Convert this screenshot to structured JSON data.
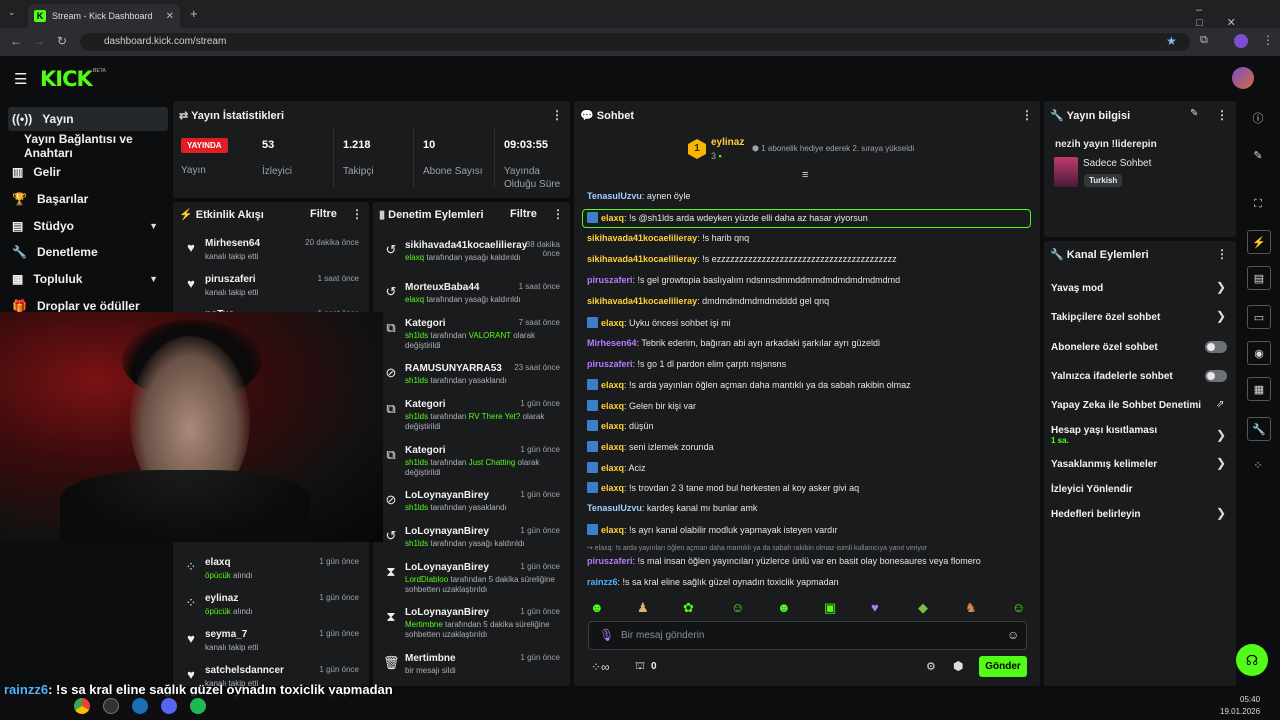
{
  "browser": {
    "tab_title": "Stream - Kick Dashboard",
    "url": "dashboard.kick.com/stream"
  },
  "header": {
    "logo": "KICK",
    "beta": "BETA"
  },
  "sidebar": {
    "items": [
      {
        "label": "Yayın",
        "icon": "broadcast-icon"
      },
      {
        "label": "Yayın Bağlantısı ve Anahtarı",
        "icon": ""
      },
      {
        "label": "Gelir",
        "icon": "chart-icon"
      },
      {
        "label": "Başarılar",
        "icon": "trophy-icon"
      },
      {
        "label": "Stüdyo",
        "icon": "studio-icon"
      },
      {
        "label": "Denetleme",
        "icon": "wrench-icon"
      },
      {
        "label": "Topluluk",
        "icon": "community-icon"
      },
      {
        "label": "Droplar ve ödüller",
        "icon": "gift-icon"
      }
    ]
  },
  "stats": {
    "title": "Yayın İstatistikleri",
    "live": "YAYINDA",
    "live_label": "Yayın",
    "items": [
      {
        "value": "53",
        "label": "İzleyici"
      },
      {
        "value": "1.218",
        "label": "Takipçi"
      },
      {
        "value": "10",
        "label": "Abone Sayısı"
      },
      {
        "value": "09:03:55",
        "label": "Yayında Olduğu Süre"
      }
    ]
  },
  "activity": {
    "title": "Etkinlik Akışı",
    "filter": "Filtre",
    "items": [
      {
        "name": "Mirhesen64",
        "sub": "kanalı takip etti",
        "time": "20 dakika önce",
        "icon": "heart-icon"
      },
      {
        "name": "piruszaferi",
        "sub": "kanalı takip etti",
        "time": "1 saat önce",
        "icon": "heart-icon"
      },
      {
        "name": "noTua",
        "sub": "",
        "time": "1 saat önce",
        "icon": "heart-icon"
      },
      {
        "name": "",
        "sub": "kanalı takip etti",
        "time": "",
        "icon": ""
      },
      {
        "name": "elaxq",
        "sub": "öpücük",
        "sub2": " alındı",
        "time": "1 gün önce",
        "icon": "dots-icon"
      },
      {
        "name": "eylinaz",
        "sub": "öpücük",
        "sub2": " alındı",
        "time": "1 gün önce",
        "icon": "dots-icon"
      },
      {
        "name": "seyma_7",
        "sub": "kanalı takip etti",
        "time": "1 gün önce",
        "icon": "heart-icon"
      },
      {
        "name": "satchelsdanncer",
        "sub": "kanalı takip etti",
        "time": "1 gün önce",
        "icon": "heart-icon"
      }
    ]
  },
  "moderation": {
    "title": "Denetim Eylemleri",
    "filter": "Filtre",
    "items": [
      {
        "name": "sikihavada41kocaelilieray",
        "a": "elaxq",
        "t": " tarafından yasağı kaldırıldı",
        "time": "38 dakika önce",
        "icon": "undo-icon"
      },
      {
        "name": "MorteuxBaba44",
        "a": "elaxq",
        "t": " tarafından yasağı kaldırıldı",
        "time": "1 saat önce",
        "icon": "undo-icon"
      },
      {
        "name": "Kategori",
        "a": "sh1lds",
        "t": " tarafından ",
        "b": "VALORANT",
        "c": " olarak değiştirildi",
        "time": "7 saat önce",
        "icon": "category-icon"
      },
      {
        "name": "RAMUSUNYARRA53",
        "a": "sh1lds",
        "t": " tarafından yasaklandı",
        "time": "23 saat önce",
        "icon": "ban-icon"
      },
      {
        "name": "Kategori",
        "a": "sh1lds",
        "t": " tarafından ",
        "b": "RV There Yet?",
        "c": " olarak değiştirildi",
        "time": "1 gün önce",
        "icon": "category-icon"
      },
      {
        "name": "Kategori",
        "a": "sh1lds",
        "t": " tarafından ",
        "b": "Just Chatting",
        "c": " olarak değiştirildi",
        "time": "1 gün önce",
        "icon": "category-icon"
      },
      {
        "name": "LoLoynayanBirey",
        "a": "sh1lds",
        "t": " tarafından yasaklandı",
        "time": "1 gün önce",
        "icon": "ban-icon"
      },
      {
        "name": "LoLoynayanBirey",
        "a": "sh1lds",
        "t": " tarafından yasağı kaldırıldı",
        "time": "1 gün önce",
        "icon": "undo-icon"
      },
      {
        "name": "LoLoynayanBirey",
        "a": "LordDiabloo",
        "t": " tarafından 5 dakika süreliğine sohbetten uzaklaştırıldı",
        "time": "1 gün önce",
        "icon": "hourglass-icon"
      },
      {
        "name": "LoLoynayanBirey",
        "a": "Mertimbne",
        "t": " tarafından 5 dakika süreliğine sohbetten uzaklaştırıldı",
        "time": "1 gün önce",
        "icon": "hourglass-icon"
      },
      {
        "name": "Mertimbne",
        "a": "",
        "t": "bir mesajı sildi",
        "time": "1 gün önce",
        "icon": "trash-icon"
      }
    ]
  },
  "chat": {
    "title": "Sohbet",
    "pinned_user": "eylinaz",
    "pinned_rank": "1",
    "pinned_count": "3",
    "pinned_text": "1 abonelik hediye ederek 2. sıraya yükseldi",
    "messages": [
      {
        "user": "TenasulUzvu",
        "color": "#9fd0ff",
        "text": "aynen öyle",
        "badge": false
      },
      {
        "user": "elaxq",
        "color": "#ffd13b",
        "text": "!s @sh1lds arda wdeyken yüzde elli daha az hasar yiyorsun",
        "badge": true
      },
      {
        "user": "sikihavada41kocaelilieray",
        "color": "#ffd13b",
        "text": "!s harib qnq",
        "badge": false
      },
      {
        "user": "sikihavada41kocaelilieray",
        "color": "#ffd13b",
        "text": "!s ezzzzzzzzzzzzzzzzzzzzzzzzzzzzzzzzzzzzzzzz",
        "badge": false
      },
      {
        "user": "piruszaferi",
        "color": "#b57cff",
        "text": "!s gel growtopia baslıyalım ndsnnsdmmddmmdmdmdmdmdmdmd",
        "badge": false
      },
      {
        "user": "sikihavada41kocaelilieray",
        "color": "#ffd13b",
        "text": "dmdmdmdmdmdmdddd gel qnq",
        "badge": false
      },
      {
        "user": "elaxq",
        "color": "#ffd13b",
        "text": "Uyku öncesi sohbet işi mi",
        "badge": true
      },
      {
        "user": "Mirhesen64",
        "color": "#b57cff",
        "text": "Tebrik ederim, bağıran abi ayrı arkadaki şarkılar ayrı güzeldi",
        "badge": false
      },
      {
        "user": "piruszaferi",
        "color": "#b57cff",
        "text": "!s go 1 dl pardon elim çarptı nsjsnsns",
        "badge": false
      },
      {
        "user": "elaxq",
        "color": "#ffd13b",
        "text": "!s arda yayınları öğlen açman daha mantıklı ya da sabah rakibin olmaz",
        "badge": true
      },
      {
        "user": "elaxq",
        "color": "#ffd13b",
        "text": "Gelen bir kişi var",
        "badge": true
      },
      {
        "user": "elaxq",
        "color": "#ffd13b",
        "text": "düşün",
        "badge": true
      },
      {
        "user": "elaxq",
        "color": "#ffd13b",
        "text": "seni izlemek zorunda",
        "badge": true
      },
      {
        "user": "elaxq",
        "color": "#ffd13b",
        "text": "Aciz",
        "badge": true
      },
      {
        "user": "elaxq",
        "color": "#ffd13b",
        "text": "!s trovdan 2 3 tane mod bul herkesten al koy asker givi aq",
        "badge": true
      },
      {
        "user": "TenasulUzvu",
        "color": "#9fd0ff",
        "text": "kardeş kanal mı bunlar amk",
        "badge": false
      },
      {
        "user": "elaxq",
        "color": "#ffd13b",
        "text": "!s ayrı kanal olabilir modluk yapmayak isteyen vardır",
        "badge": true
      }
    ],
    "reply_note": "↪ elaxq: !s arda yayınları öğlen açman daha mantıklı ya da sabah rakibin olmaz isimli kullanıcıya yanıt veriyor",
    "messages2": [
      {
        "user": "piruszaferi",
        "color": "#b57cff",
        "text": "!s mal insan öğlen yayıncıları yüzlerce ünlü var en basit olay bonesaures veya flomero"
      },
      {
        "user": "rainzz6",
        "color": "#4fb3ff",
        "text": "!s sa kral eline sağlık güzel oynadın toxiclik yapmadan"
      }
    ],
    "input_placeholder": "Bir mesaj gönderin",
    "points": "0",
    "send": "Gönder"
  },
  "stream_info": {
    "title": "Yayın bilgisi",
    "stream_title": "nezih yayın !liderepin",
    "category": "Sadece Sohbet",
    "language": "Turkish"
  },
  "channel_actions": {
    "title": "Kanal Eylemleri",
    "items": [
      {
        "label": "Yavaş mod",
        "type": "chevron"
      },
      {
        "label": "Takipçilere özel sohbet",
        "type": "chevron"
      },
      {
        "label": "Abonelere özel sohbet",
        "type": "toggle"
      },
      {
        "label": "Yalnızca ifadelerle sohbet",
        "type": "toggle"
      },
      {
        "label": "Yapay Zeka ile Sohbet Denetimi",
        "type": "link"
      },
      {
        "label": "Hesap yaşı kısıtlaması",
        "sub": "1 sa.",
        "type": "chevron"
      },
      {
        "label": "Yasaklanmış kelimeler",
        "type": "chevron"
      },
      {
        "label": "İzleyici Yönlendir",
        "type": "none"
      },
      {
        "label": "Hedefleri belirleyin",
        "type": "chevron"
      }
    ]
  },
  "overlay": {
    "user": "rainzz6",
    "text": ": !s sa kral eline sağlık güzel oynadın toxiclik yapmadan"
  },
  "taskbar": {
    "time": "05:40",
    "date": "19.01.2026"
  },
  "colors": {
    "accent": "#53fc18",
    "panel": "#191b1d",
    "bg": "#0b0d0e"
  }
}
